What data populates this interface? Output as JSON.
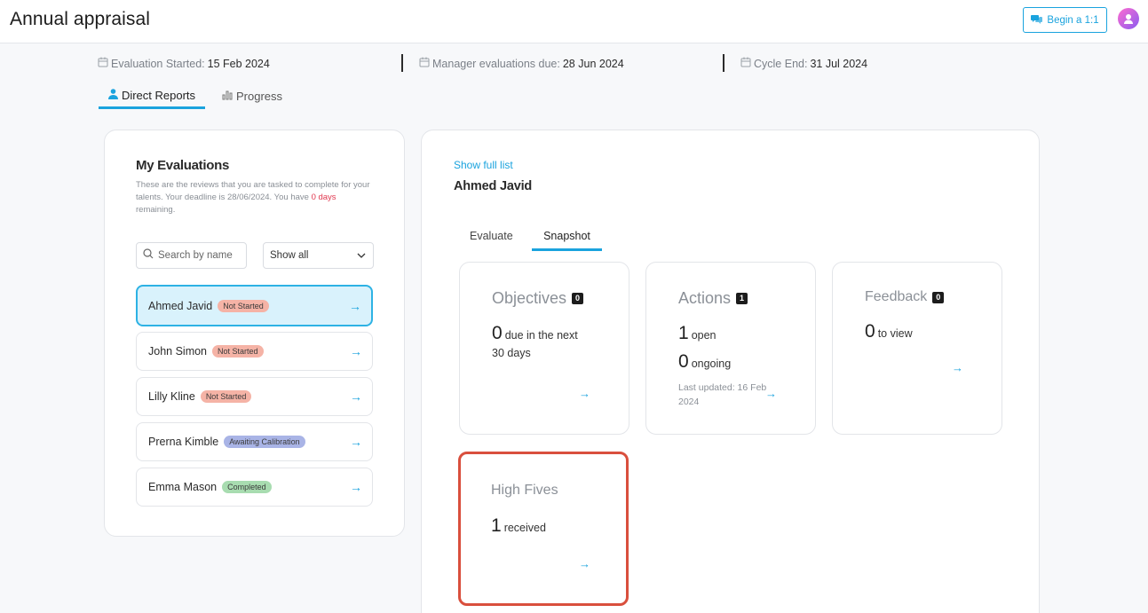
{
  "header": {
    "title": "Annual appraisal",
    "begin_button": "Begin a 1:1"
  },
  "dates": {
    "started_label": "Evaluation Started:",
    "started_value": "15 Feb 2024",
    "manager_due_label": "Manager evaluations due:",
    "manager_due_value": "28 Jun 2024",
    "cycle_end_label": "Cycle End:",
    "cycle_end_value": "31 Jul 2024"
  },
  "main_tabs": [
    {
      "label": "Direct Reports",
      "active": true
    },
    {
      "label": "Progress",
      "active": false
    }
  ],
  "evaluations": {
    "title": "My Evaluations",
    "desc_before": "These are the reviews that you are tasked to complete for your talents. Your deadline is 28/06/2024. You have ",
    "desc_red": "0 days",
    "desc_after": " remaining.",
    "search_placeholder": "Search by name",
    "filter_value": "Show all",
    "people": [
      {
        "name": "Ahmed Javid",
        "status": "Not Started"
      },
      {
        "name": "John Simon",
        "status": "Not Started"
      },
      {
        "name": "Lilly Kline",
        "status": "Not Started"
      },
      {
        "name": "Prerna Kimble",
        "status": "Awaiting Calibration"
      },
      {
        "name": "Emma Mason",
        "status": "Completed"
      }
    ]
  },
  "detail": {
    "show_full_list": "Show full list",
    "employee_name": "Ahmed Javid",
    "tabs": [
      {
        "label": "Evaluate",
        "active": false
      },
      {
        "label": "Snapshot",
        "active": true
      }
    ],
    "objectives": {
      "title": "Objectives",
      "count": "0",
      "value": "0",
      "text": "due in the next",
      "text2": "30 days"
    },
    "actions": {
      "title": "Actions",
      "count": "1",
      "open_value": "1",
      "open_text": "open",
      "ongoing_value": "0",
      "ongoing_text": "ongoing",
      "updated": "Last updated: 16 Feb 2024"
    },
    "feedback": {
      "title": "Feedback",
      "count": "0",
      "value": "0",
      "text": "to view"
    },
    "high_fives": {
      "title": "High Fives",
      "value": "1",
      "text": "received"
    }
  },
  "colors": {
    "accent": "#1aa3de",
    "highlight": "#d94f3d"
  }
}
